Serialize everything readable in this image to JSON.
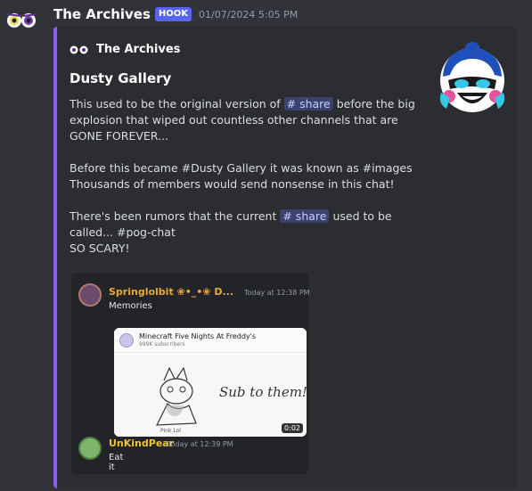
{
  "message": {
    "author": "The Archives",
    "badge": "HOOK",
    "timestamp": "01/07/2024 5:05 PM"
  },
  "embed": {
    "author_name": "The Archives",
    "title": "Dusty Gallery",
    "description": {
      "line1_pre": "This used to be the original version of ",
      "mention1": "# share",
      "line1_post": " before the big explosion that wiped out countless other channels that are GONE FOREVER...",
      "line2": "Before this became #Dusty Gallery it was known as #images",
      "line3": "Thousands of members would send nonsense in this chat!",
      "line4_pre": "There's been rumors that the current ",
      "mention2": "# share",
      "line4_post": " used to be called... #pog-chat",
      "line5": "SO SCARY!"
    },
    "accent_color": "#8c5cf6"
  },
  "quoted": {
    "messages": [
      {
        "name": "Springlolbit ❀•_•❀ D...",
        "time": "Today at 12:38 PM",
        "text": "Memories",
        "name_color": "#e8a93a"
      },
      {
        "name": "UnKindPear",
        "time": "Today at 12:39 PM",
        "text": "Eat it",
        "name_color": "#f0c23a"
      }
    ],
    "video": {
      "channel": "Minecraft Five Nights At Freddy's",
      "subscribers": "999K subscribers",
      "caption": "Sub to them!!!",
      "duration": "0:02"
    }
  }
}
